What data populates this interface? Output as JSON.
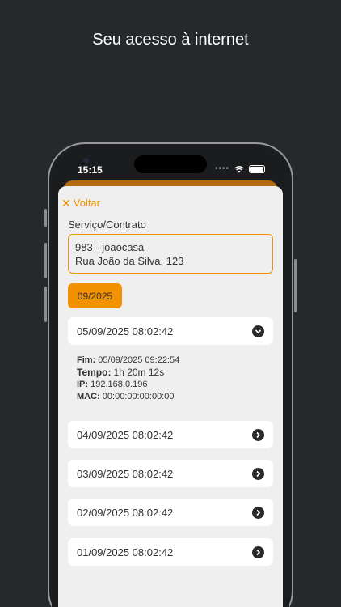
{
  "promo": {
    "title": "Seu acesso à internet"
  },
  "status_bar": {
    "time": "15:15"
  },
  "nav": {
    "back_label": "Voltar"
  },
  "service": {
    "label": "Serviço/Contrato",
    "line1": "983 - joaocasa",
    "line2": "Rua João da Silva, 123"
  },
  "month_filter": {
    "label": "09/2025"
  },
  "sessions": [
    {
      "start": "05/09/2025 08:02:42",
      "state": "expanded",
      "icon": "chevron-down-icon"
    },
    {
      "start": "04/09/2025 08:02:42",
      "state": "collapsed",
      "icon": "chevron-right-icon"
    },
    {
      "start": "03/09/2025 08:02:42",
      "state": "collapsed",
      "icon": "chevron-right-icon"
    },
    {
      "start": "02/09/2025 08:02:42",
      "state": "collapsed",
      "icon": "chevron-right-icon"
    },
    {
      "start": "01/09/2025 08:02:42",
      "state": "collapsed",
      "icon": "chevron-right-icon"
    }
  ],
  "expanded_details": {
    "fim_label": "Fim:",
    "fim_value": "05/09/2025 09:22:54",
    "tempo_label": "Tempo:",
    "tempo_value": "1h 20m 12s",
    "ip_label": "IP:",
    "ip_value": "192.168.0.196",
    "mac_label": "MAC:",
    "mac_value": "00:00:00:00:00:00"
  },
  "colors": {
    "accent": "#f39200",
    "background": "#26292c",
    "sheet": "#efefef"
  }
}
